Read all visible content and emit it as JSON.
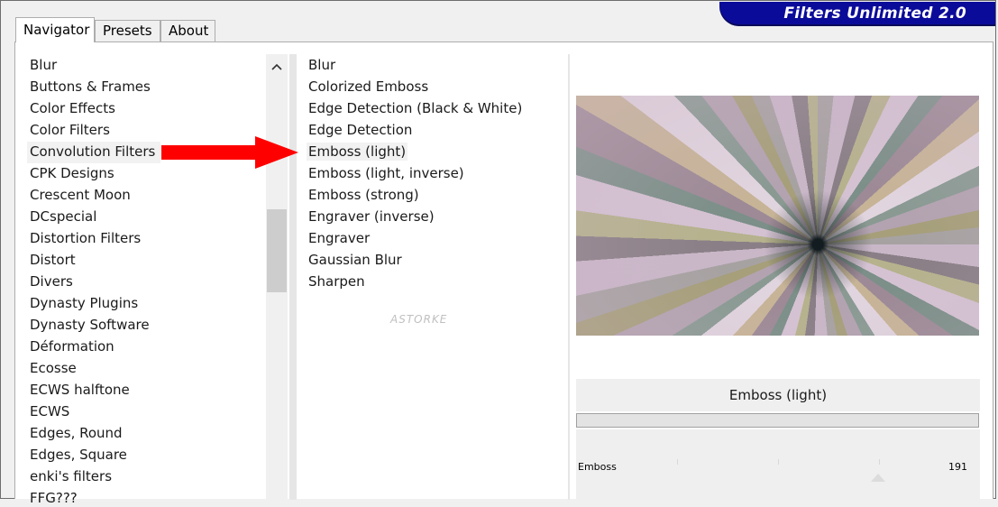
{
  "app": {
    "title": "Filters Unlimited 2.0"
  },
  "tabs": [
    {
      "label": "Navigator"
    },
    {
      "label": "Presets"
    },
    {
      "label": "About"
    }
  ],
  "categories": [
    "Blur",
    "Buttons & Frames",
    "Color Effects",
    "Color Filters",
    "Convolution Filters",
    "CPK Designs",
    "Crescent Moon",
    "DCspecial",
    "Distortion Filters",
    "Distort",
    "Divers",
    "Dynasty Plugins",
    "Dynasty Software",
    "Déformation",
    "Ecosse",
    "ECWS halftone",
    "ECWS",
    "Edges, Round",
    "Edges, Square",
    "enki's filters",
    "FFG???"
  ],
  "filters": [
    "Blur",
    "Colorized Emboss",
    "Edge Detection (Black & White)",
    "Edge Detection",
    "Emboss (light)",
    "Emboss (light, inverse)",
    "Emboss (strong)",
    "Engraver (inverse)",
    "Engraver",
    "Gaussian Blur",
    "Sharpen"
  ],
  "selected_filter": "Emboss (light)",
  "control": {
    "label": "Emboss",
    "value": "191"
  },
  "watermark": "ASTORKE",
  "colors": {
    "banner": "#0b0b9a",
    "arrow": "#ff0000"
  }
}
